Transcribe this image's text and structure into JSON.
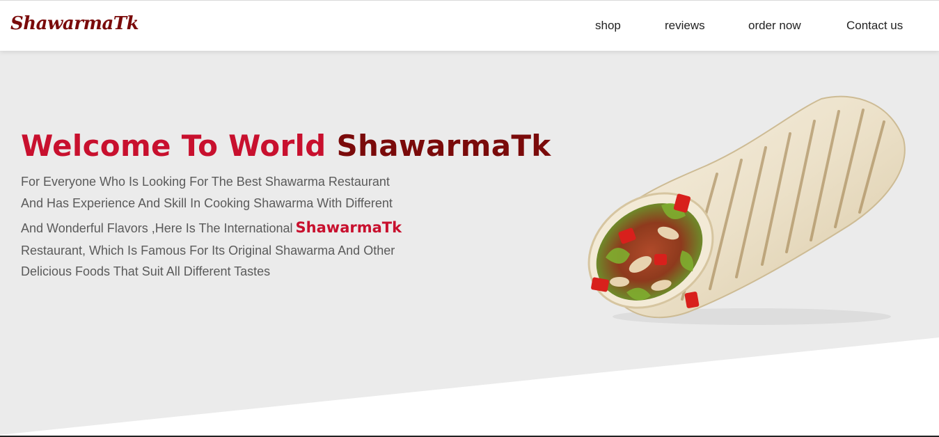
{
  "brand": {
    "logo": "ShawarmaTk"
  },
  "nav": {
    "items": [
      {
        "label": "shop"
      },
      {
        "label": "reviews"
      },
      {
        "label": "order now"
      },
      {
        "label": "Contact us"
      }
    ]
  },
  "hero": {
    "headline_welcome": "Welcome To World",
    "headline_brand": "ShawarmaTk",
    "desc_line1": "For Everyone Who Is Looking For The Best Shawarma Restaurant",
    "desc_line2": "And Has Experience And Skill In Cooking Shawarma With Different",
    "desc_line3": "And Wonderful Flavors ,Here Is The International",
    "desc_brand": "ShawarmaTk",
    "desc_line4": "Restaurant, Which Is Famous For Its Original Shawarma And Other",
    "desc_line5": "Delicious Foods That Suit All Different Tastes"
  },
  "colors": {
    "accent_red": "#c8102e",
    "brand_dark_red": "#7a0a0a",
    "hero_background": "#ebebeb"
  }
}
